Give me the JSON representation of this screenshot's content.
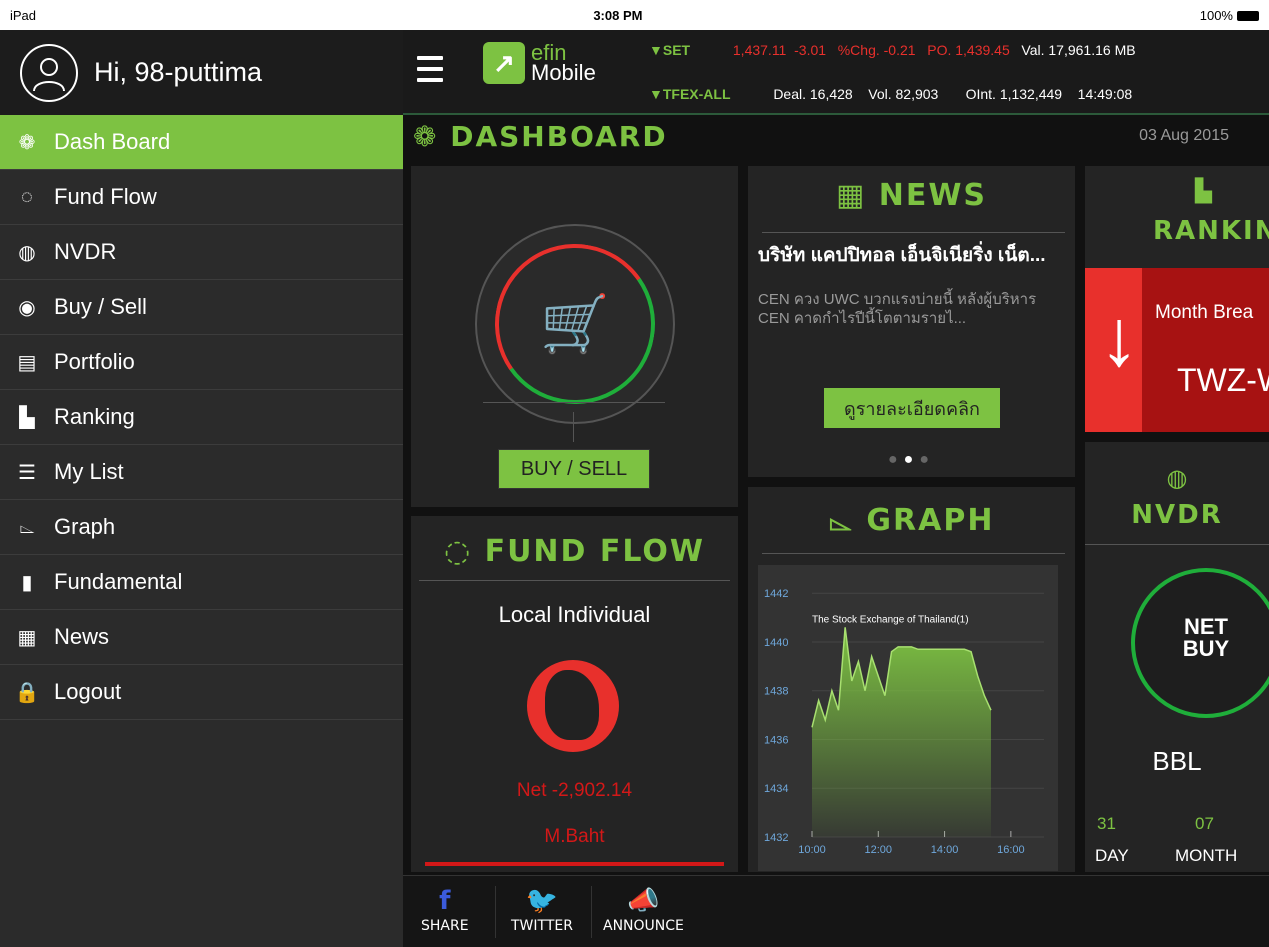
{
  "status": {
    "device": "iPad",
    "time": "3:08 PM",
    "battery": "100%"
  },
  "user": {
    "greeting": "Hi, 98-puttima"
  },
  "sidebar": {
    "items": [
      {
        "label": "Dash Board",
        "icon": "dashboard-icon"
      },
      {
        "label": "Fund Flow",
        "icon": "fund-flow-icon"
      },
      {
        "label": "NVDR",
        "icon": "globe-icon"
      },
      {
        "label": "Buy / Sell",
        "icon": "buy-sell-icon"
      },
      {
        "label": "Portfolio",
        "icon": "portfolio-icon"
      },
      {
        "label": "Ranking",
        "icon": "ranking-icon"
      },
      {
        "label": "My List",
        "icon": "list-icon"
      },
      {
        "label": "Graph",
        "icon": "graph-icon"
      },
      {
        "label": "Fundamental",
        "icon": "fundamental-icon"
      },
      {
        "label": "News",
        "icon": "news-icon"
      },
      {
        "label": "Logout",
        "icon": "lock-icon"
      }
    ]
  },
  "brand": {
    "line1": "efin",
    "line2": "Mobile"
  },
  "ticker": {
    "set": {
      "name": "SET",
      "index": "1,437.11",
      "change": "-3.01",
      "pct": "%Chg. -0.21",
      "po": "PO. 1,439.45",
      "val": "Val. 17,961.16 MB"
    },
    "tfex": {
      "name": "TFEX-ALL",
      "deal": "Deal. 16,428",
      "vol": "Vol. 82,903",
      "oint": "OInt. 1,132,449",
      "time": "14:49:08"
    }
  },
  "dashboard": {
    "title": "DASHBOARD",
    "date": "03 Aug 2015"
  },
  "buy_sell": {
    "button": "BUY / SELL"
  },
  "news": {
    "title": "NEWS",
    "headline": "บริษัท แคปปิทอล เอ็นจิเนียริ่ง เน็ต...",
    "body": "CEN ควง UWC บวกแรงบ่ายนี้ หลังผู้บริหาร CEN คาดกำไรปีนี้โตตามรายไ...",
    "button": "ดูรายละเอียดคลิก"
  },
  "ranking": {
    "title": "RANKING",
    "label": "Month Brea",
    "symbol": "TWZ-W"
  },
  "fund_flow": {
    "title": "FUND FLOW",
    "subtitle": "Local Individual",
    "net": "Net -2,902.14",
    "unit": "M.Baht"
  },
  "graph": {
    "title": "GRAPH",
    "chart_data": {
      "type": "area",
      "title": "The Stock Exchange of Thailand(1)",
      "xlabel": "",
      "ylabel": "",
      "x_ticks": [
        "10:00",
        "12:00",
        "14:00",
        "16:00"
      ],
      "y_ticks": [
        1432,
        1434,
        1436,
        1438,
        1440,
        1442
      ],
      "ylim": [
        1432,
        1442.5
      ],
      "xlim": [
        10.0,
        17.0
      ],
      "color": "#7dc242",
      "x": [
        10.0,
        10.2,
        10.4,
        10.6,
        10.8,
        11.0,
        11.2,
        11.4,
        11.6,
        11.8,
        12.0,
        12.2,
        12.4,
        12.6,
        12.8,
        13.0,
        13.2,
        13.4,
        13.6,
        13.8,
        14.0,
        14.2,
        14.4,
        14.6,
        14.8,
        15.0,
        15.2,
        15.4
      ],
      "y": [
        1436.5,
        1437.6,
        1436.8,
        1438.0,
        1437.2,
        1440.6,
        1438.4,
        1439.2,
        1438.0,
        1439.4,
        1438.6,
        1437.8,
        1439.6,
        1439.8,
        1439.8,
        1439.8,
        1439.7,
        1439.7,
        1439.7,
        1439.7,
        1439.7,
        1439.7,
        1439.7,
        1439.7,
        1439.6,
        1438.6,
        1437.8,
        1437.2
      ]
    }
  },
  "nvdr": {
    "title": "NVDR",
    "badge_line1": "NET",
    "badge_line2": "BUY",
    "symbol": "BBL",
    "day_value": "31",
    "month_value": "07",
    "day_label": "DAY",
    "month_label": "MONTH"
  },
  "bottom": {
    "share": "SHARE",
    "twitter": "TWITTER",
    "announce": "ANNOUNCE"
  },
  "colors": {
    "accent": "#7dc242",
    "negative": "#e8302c",
    "positive": "#1fae3a"
  }
}
